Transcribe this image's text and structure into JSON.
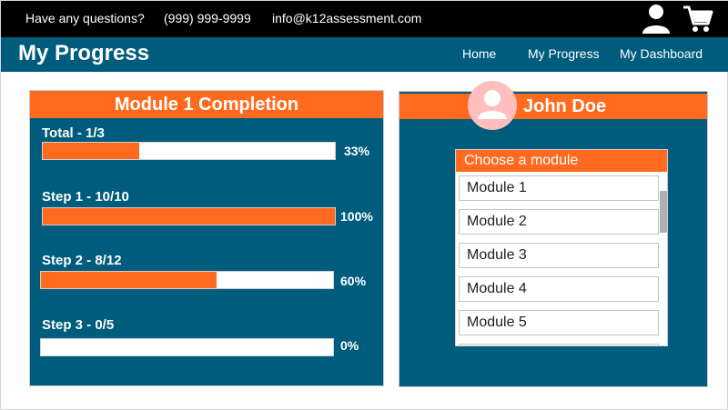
{
  "topbar": {
    "question": "Have any questions?",
    "phone": "(999) 999-9999",
    "email": "info@k12assessment.com"
  },
  "navbar": {
    "title": "My Progress",
    "links": [
      "Home",
      "My Progress",
      "My Dashboard"
    ]
  },
  "completion": {
    "header": "Module 1 Completion",
    "steps": [
      {
        "label": "Total - 1/3",
        "percent_text": "33%",
        "progress": 0.33
      },
      {
        "label": "Step 1 - 10/10",
        "percent_text": "100%",
        "progress": 1.0
      },
      {
        "label": "Step 2 - 8/12",
        "percent_text": "60%",
        "progress": 0.6
      },
      {
        "label": "Step 3 - 0/5",
        "percent_text": "0%",
        "progress": 0.0
      }
    ]
  },
  "profile": {
    "name": "John Doe",
    "chooser_label": "Choose a module",
    "modules": [
      "Module 1",
      "Module 2",
      "Module 3",
      "Module 4",
      "Module 5"
    ]
  },
  "colors": {
    "accent": "#ff6a1f",
    "panel": "#005c7c",
    "topbar": "#000000",
    "avatar_bg": "#ffbfbf"
  },
  "icons": {
    "user": "user-icon",
    "cart": "cart-icon",
    "avatar": "avatar-person-icon"
  }
}
